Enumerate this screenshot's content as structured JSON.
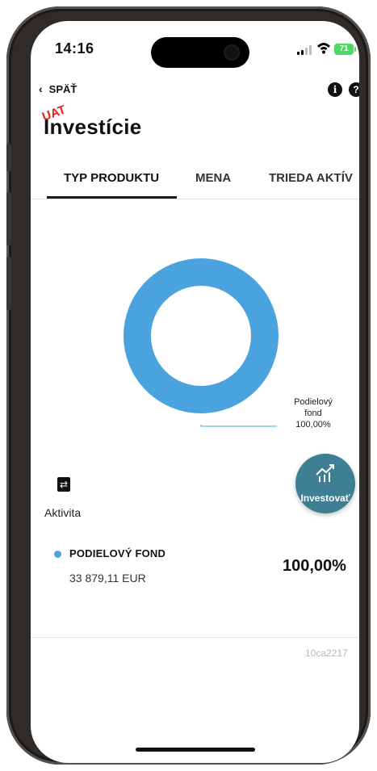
{
  "status_bar": {
    "time": "14:16",
    "battery": "71"
  },
  "nav": {
    "back_label": "SPÄŤ"
  },
  "header": {
    "badge": "UAT",
    "title": "Investície"
  },
  "tabs": [
    {
      "label": "TYP PRODUKTU",
      "active": true
    },
    {
      "label": "MENA",
      "active": false
    },
    {
      "label": "TRIEDA AKTÍV",
      "active": false
    }
  ],
  "chart_data": {
    "type": "pie",
    "categories": [
      "Podielový fond"
    ],
    "values": [
      100.0
    ],
    "slice_labels": [
      [
        "Podielový",
        "fond",
        "100,00%"
      ]
    ],
    "colors": [
      "#4aa3de"
    ]
  },
  "activity": {
    "label": "Aktivita"
  },
  "invest_button": {
    "label": "Investovať"
  },
  "holdings": [
    {
      "name": "PODIELOVÝ FOND",
      "amount": "33 879,11 EUR",
      "percent": "100,00%",
      "color": "#4aa3de"
    }
  ],
  "build_id": "10ca2217"
}
